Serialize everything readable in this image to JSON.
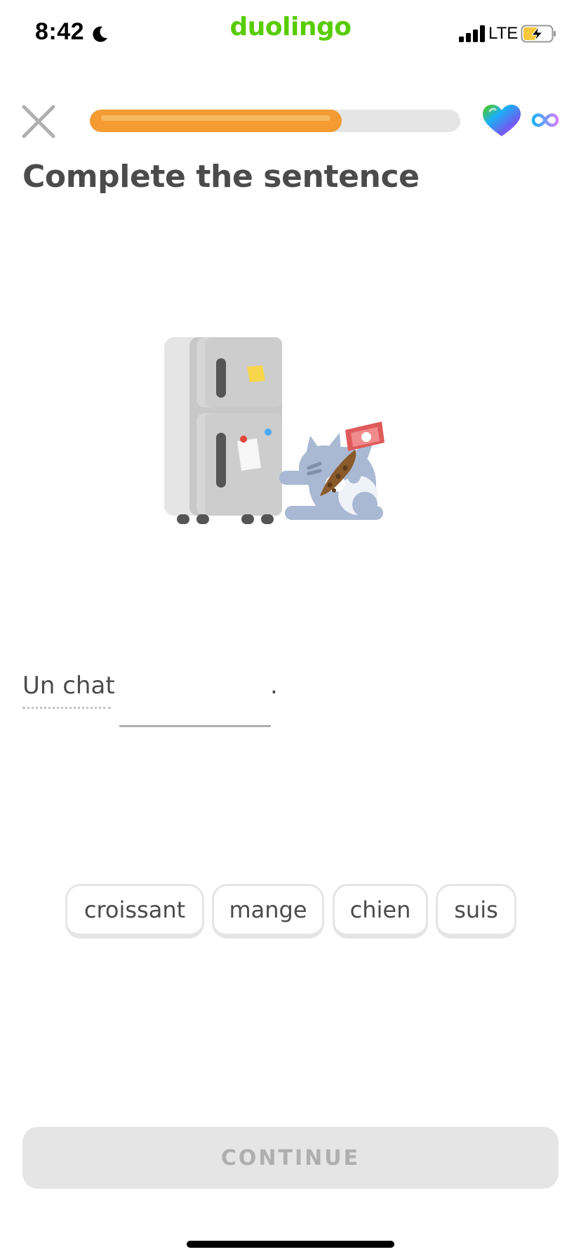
{
  "status_bar": {
    "time": "8:42",
    "network": "LTE",
    "brand": "duolingo",
    "icons": [
      "moon-icon",
      "signal-icon",
      "battery-charging-icon"
    ]
  },
  "lesson": {
    "progress_fraction": 0.68,
    "hearts": "∞",
    "icons": [
      "close-icon",
      "heart-icon",
      "infinity-icon"
    ]
  },
  "instruction": "Complete the sentence",
  "sentence": {
    "start": "Un chat",
    "end": "."
  },
  "word_bank": [
    "croissant",
    "mange",
    "chien",
    "suis"
  ],
  "continue_label": "CONTINUE",
  "colors": {
    "brand_green": "#58cc02",
    "progress": "#f49b31",
    "progress_track": "#e5e5e5",
    "text": "#4b4b4b",
    "disabled": "#afafaf"
  }
}
